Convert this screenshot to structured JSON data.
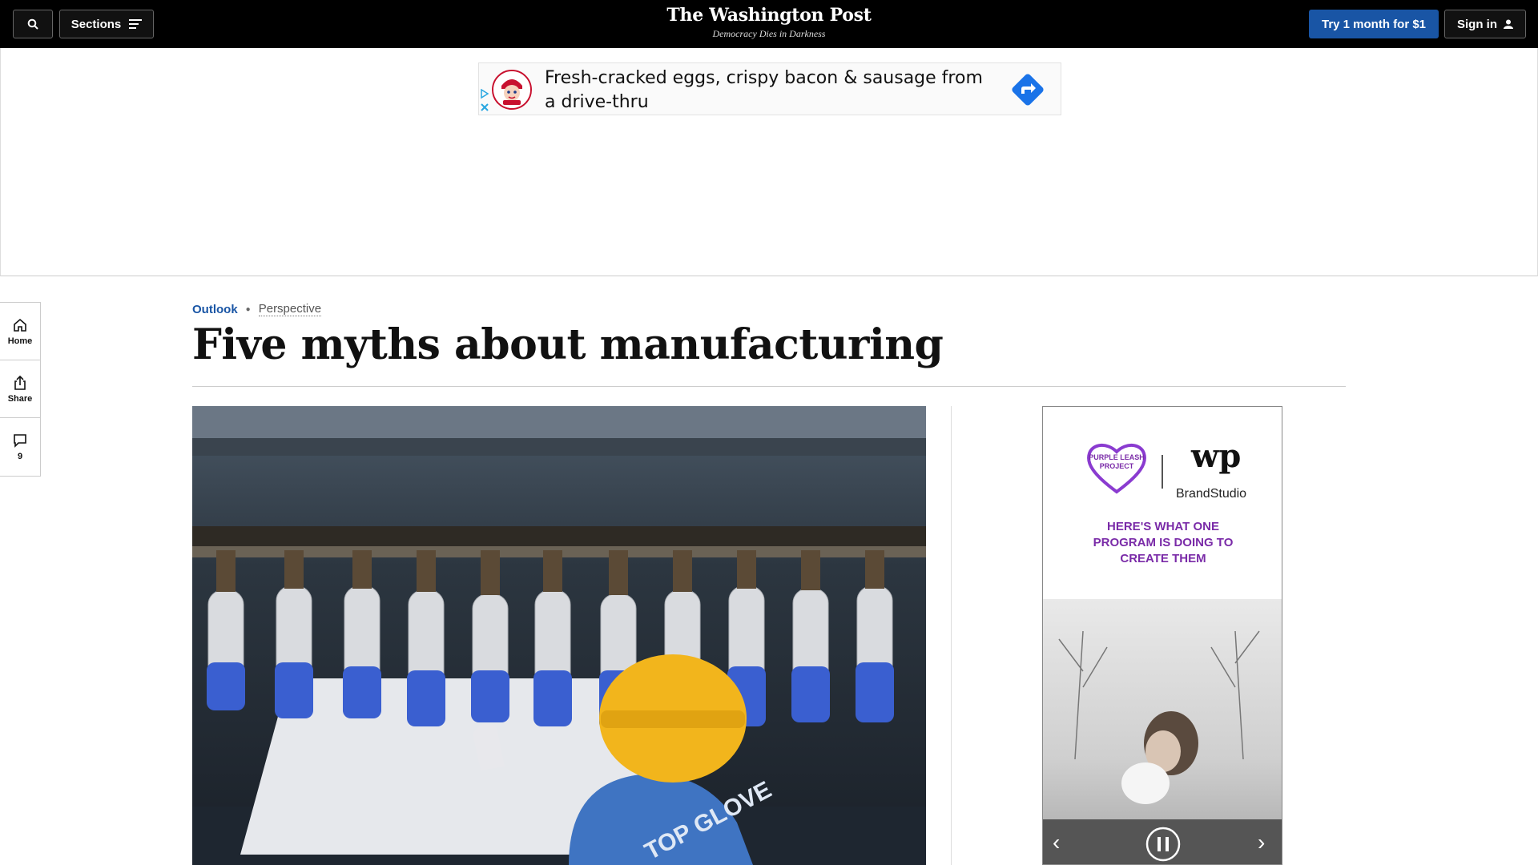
{
  "topbar": {
    "sections_label": "Sections",
    "logo": "The Washington Post",
    "tagline": "Democracy Dies in Darkness",
    "try_label": "Try 1 month for $1",
    "signin_label": "Sign in"
  },
  "ad": {
    "text": "Fresh-cracked eggs, crispy bacon & sausage from a drive-thru"
  },
  "rail": {
    "home_label": "Home",
    "share_label": "Share",
    "comments_count": "9"
  },
  "article": {
    "section": "Outlook",
    "label": "Perspective",
    "headline": "Five myths about manufacturing",
    "hero_text": "TOP GLOVE"
  },
  "side_ad": {
    "brand": "BrandStudio",
    "headline": "HERE'S WHAT ONE PROGRAM IS DOING TO CREATE THEM",
    "logo_text": "PURPLE LEASH PROJECT"
  },
  "colors": {
    "accent": "#1955a5",
    "purple": "#7a2ba8"
  }
}
